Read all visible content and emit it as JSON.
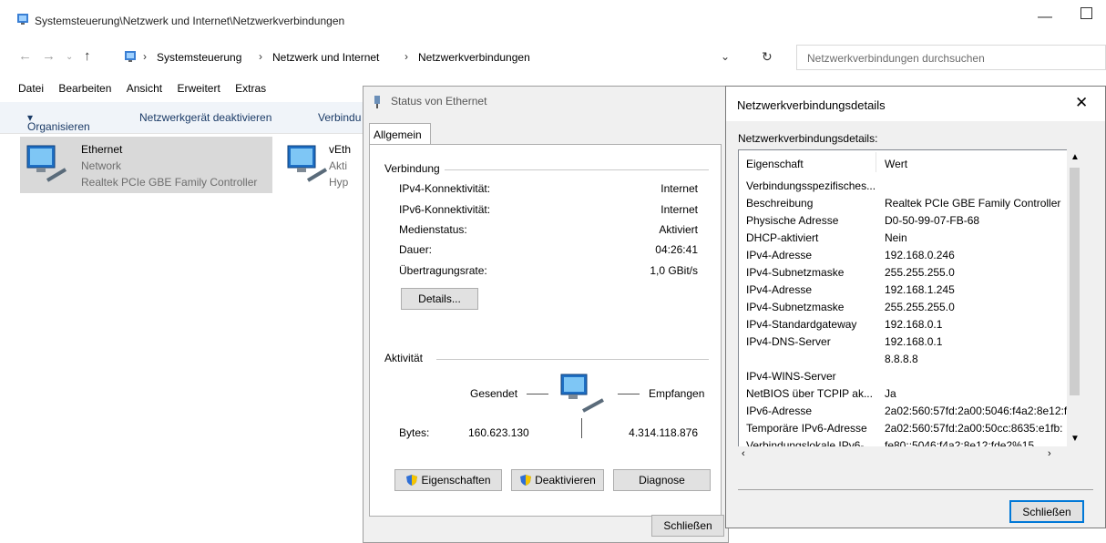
{
  "explorer": {
    "window_title": "Systemsteuerung\\Netzwerk und Internet\\Netzwerkverbindungen",
    "breadcrumb": [
      "Systemsteuerung",
      "Netzwerk und Internet",
      "Netzwerkverbindungen"
    ],
    "search_placeholder": "Netzwerkverbindungen durchsuchen",
    "menu": [
      "Datei",
      "Bearbeiten",
      "Ansicht",
      "Erweitert",
      "Extras"
    ],
    "toolbar": {
      "organize": "Organisieren",
      "disable_device": "Netzwerkgerät deaktivieren",
      "connect_partial": "Verbindu"
    },
    "items": [
      {
        "name": "Ethernet",
        "line2": "Network",
        "line3": "Realtek PCIe GBE Family Controller"
      },
      {
        "name": "vEth",
        "line2": "Akti",
        "line3": "Hyp"
      }
    ]
  },
  "status_dialog": {
    "title": "Status von Ethernet",
    "tab": "Allgemein",
    "connection_header": "Verbindung",
    "rows": [
      {
        "label": "IPv4-Konnektivität:",
        "value": "Internet"
      },
      {
        "label": "IPv6-Konnektivität:",
        "value": "Internet"
      },
      {
        "label": "Medienstatus:",
        "value": "Aktiviert"
      },
      {
        "label": "Dauer:",
        "value": "04:26:41"
      },
      {
        "label": "Übertragungsrate:",
        "value": "1,0 GBit/s"
      }
    ],
    "details_button": "Details...",
    "activity_header": "Aktivität",
    "sent_label": "Gesendet",
    "received_label": "Empfangen",
    "bytes_label": "Bytes:",
    "bytes_sent": "160.623.130",
    "bytes_received": "4.314.118.876",
    "properties_button": "Eigenschaften",
    "disable_button": "Deaktivieren",
    "diagnose_button": "Diagnose",
    "close_button": "Schließen"
  },
  "details_dialog": {
    "title": "Netzwerkverbindungsdetails",
    "label": "Netzwerkverbindungsdetails:",
    "col_property": "Eigenschaft",
    "col_value": "Wert",
    "rows": [
      {
        "property": "Verbindungsspezifisches...",
        "value": ""
      },
      {
        "property": "Beschreibung",
        "value": "Realtek PCIe GBE Family Controller"
      },
      {
        "property": "Physische Adresse",
        "value": "D0-50-99-07-FB-68"
      },
      {
        "property": "DHCP-aktiviert",
        "value": "Nein"
      },
      {
        "property": "IPv4-Adresse",
        "value": "192.168.0.246"
      },
      {
        "property": "IPv4-Subnetzmaske",
        "value": "255.255.255.0"
      },
      {
        "property": "IPv4-Adresse",
        "value": "192.168.1.245"
      },
      {
        "property": "IPv4-Subnetzmaske",
        "value": "255.255.255.0"
      },
      {
        "property": "IPv4-Standardgateway",
        "value": "192.168.0.1"
      },
      {
        "property": "IPv4-DNS-Server",
        "value": "192.168.0.1"
      },
      {
        "property": "",
        "value": "8.8.8.8"
      },
      {
        "property": "IPv4-WINS-Server",
        "value": ""
      },
      {
        "property": "NetBIOS über TCPIP ak...",
        "value": "Ja"
      },
      {
        "property": "IPv6-Adresse",
        "value": "2a02:560:57fd:2a00:5046:f4a2:8e12:f"
      },
      {
        "property": "Temporäre IPv6-Adresse",
        "value": "2a02:560:57fd:2a00:50cc:8635:e1fb:"
      },
      {
        "property": "Verbindungslokale IPv6-...",
        "value": "fe80::5046:f4a2:8e12:fde2%15"
      }
    ],
    "close_button": "Schließen"
  },
  "colors": {
    "selection": "#d9d9d9",
    "toolbar_bg": "#f0f4f9",
    "dialog_bg": "#f0f0f0",
    "accent_border": "#0078d7"
  }
}
